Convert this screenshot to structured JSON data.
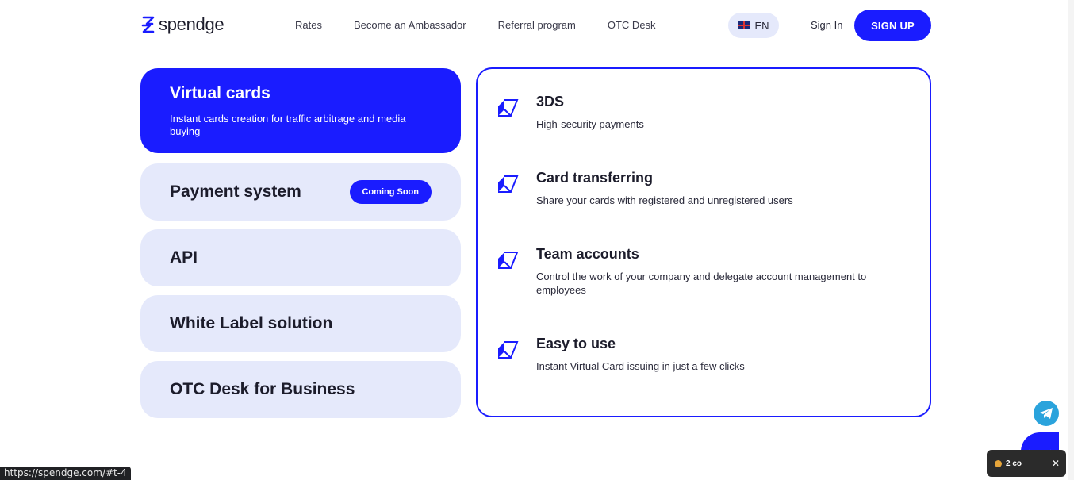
{
  "header": {
    "brand": "spendge",
    "nav": [
      "Rates",
      "Become an Ambassador",
      "Referral program",
      "OTC Desk"
    ],
    "lang": "EN",
    "sign_in": "Sign In",
    "sign_up": "SIGN UP"
  },
  "tabs": [
    {
      "title": "Virtual cards",
      "desc": "Instant cards creation for traffic arbitrage and media buying"
    },
    {
      "title": "Payment system",
      "badge": "Coming Soon"
    },
    {
      "title": "API"
    },
    {
      "title": "White Label solution"
    },
    {
      "title": "OTC Desk for Business"
    }
  ],
  "features": [
    {
      "title": "3DS",
      "desc": "High-security payments"
    },
    {
      "title": "Card transferring",
      "desc": "Share your cards with registered and unregistered users"
    },
    {
      "title": "Team accounts",
      "desc": "Control the work of your company and delegate account management to employees"
    },
    {
      "title": "Easy to use",
      "desc": "Instant Virtual Card issuing in just a few clicks"
    }
  ],
  "cookie": {
    "label": "2 co",
    "close": "✕"
  },
  "status_url": "https://spendge.com/#t-4",
  "colors": {
    "accent": "#1a1cff",
    "tab_bg": "#e5e9fb",
    "telegram": "#2aa3dc"
  }
}
